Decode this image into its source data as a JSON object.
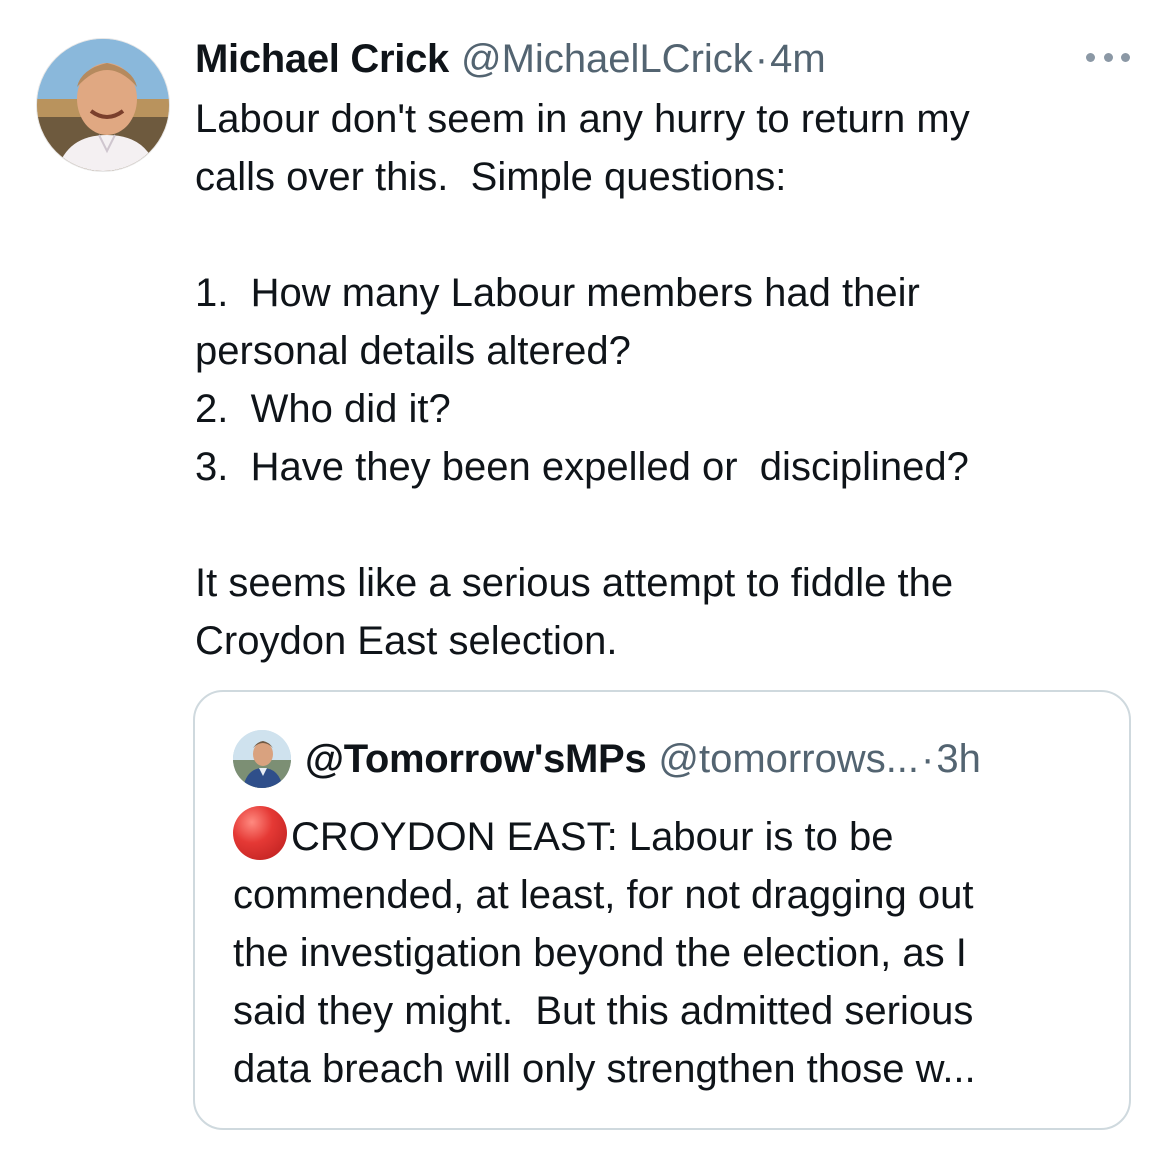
{
  "tweet": {
    "author_name": "Michael Crick",
    "author_handle": "@MichaelLCrick",
    "separator": "·",
    "time": "4m",
    "lines": [
      "Labour don't seem in any hurry to return my",
      "calls over this.  Simple questions:",
      "",
      "1.  How many Labour members had their",
      "personal details altered?",
      "2.  Who did it?",
      "3.  Have they been expelled or  disciplined?",
      "",
      "It seems like a serious attempt to fiddle the",
      "Croydon East selection."
    ],
    "avatar_icon": "profile-photo"
  },
  "quoted_tweet": {
    "author_name": "@Tomorrow'sMPs",
    "author_handle": "@tomorrows...",
    "separator": "·",
    "time": "3h",
    "emoji": "red-circle",
    "first_line": "CROYDON EAST: Labour is to be",
    "lines": [
      "commended, at least, for not dragging out",
      "the investigation beyond the election, as I",
      "said they might.  But this admitted serious",
      "data breach will only strengthen those w..."
    ]
  },
  "colors": {
    "text": "#0f1419",
    "secondary": "#536471",
    "border": "#cfd9de",
    "more_dots": "#8b98a5"
  }
}
